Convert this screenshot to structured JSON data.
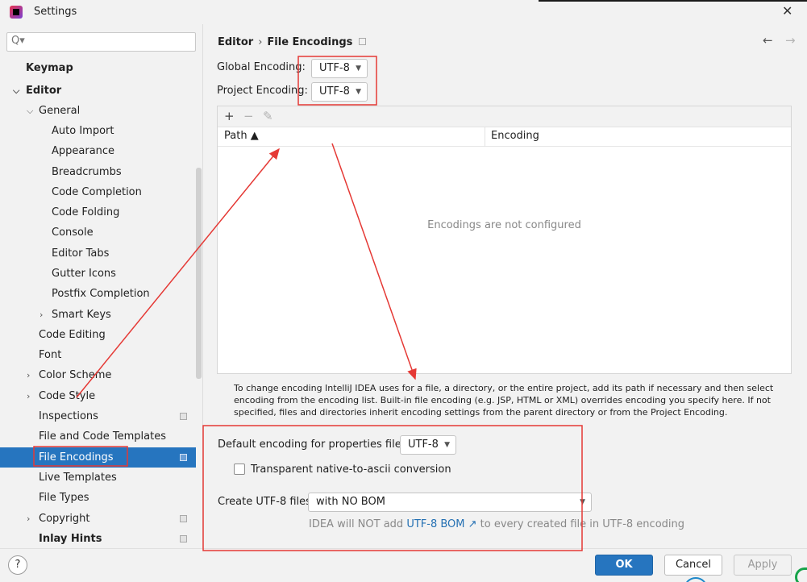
{
  "window": {
    "title": "Settings",
    "close_glyph": "✕"
  },
  "search": {
    "placeholder": "Q▾"
  },
  "sidebar": {
    "items": [
      {
        "label": "Keymap"
      },
      {
        "label": "Editor"
      },
      {
        "label": "General"
      },
      {
        "label": "Auto Import"
      },
      {
        "label": "Appearance"
      },
      {
        "label": "Breadcrumbs"
      },
      {
        "label": "Code Completion"
      },
      {
        "label": "Code Folding"
      },
      {
        "label": "Console"
      },
      {
        "label": "Editor Tabs"
      },
      {
        "label": "Gutter Icons"
      },
      {
        "label": "Postfix Completion"
      },
      {
        "label": "Smart Keys"
      },
      {
        "label": "Code Editing"
      },
      {
        "label": "Font"
      },
      {
        "label": "Color Scheme"
      },
      {
        "label": "Code Style"
      },
      {
        "label": "Inspections"
      },
      {
        "label": "File and Code Templates"
      },
      {
        "label": "File Encodings"
      },
      {
        "label": "Live Templates"
      },
      {
        "label": "File Types"
      },
      {
        "label": "Copyright"
      },
      {
        "label": "Inlay Hints"
      }
    ],
    "selected": "File Encodings"
  },
  "breadcrumb": {
    "parent": "Editor",
    "separator": "›",
    "current": "File Encodings"
  },
  "nav": {
    "back": "←",
    "forward": "→"
  },
  "encoding": {
    "global_label": "Global Encoding:",
    "global_value": "UTF-8",
    "project_label": "Project Encoding:",
    "project_value": "UTF-8"
  },
  "table": {
    "toolbar": {
      "add": "+",
      "remove": "−",
      "edit": "✎"
    },
    "columns": [
      "Path ▲",
      "Encoding"
    ],
    "empty_text": "Encodings are not configured"
  },
  "help_text": "To change encoding IntelliJ IDEA uses for a file, a directory, or the entire project, add its path if necessary and then select encoding from the encoding list. Built-in file encoding (e.g. JSP, HTML or XML) overrides encoding you specify here. If not specified, files and directories inherit encoding settings from the parent directory or from the Project Encoding.",
  "properties": {
    "default_label": "Default encoding for properties files:",
    "default_value": "UTF-8",
    "transparent_label": "Transparent native-to-ascii conversion",
    "transparent_checked": false
  },
  "utf8": {
    "create_label": "Create UTF-8 files:",
    "create_value": "with NO BOM",
    "hint_prefix": "IDEA will NOT add",
    "hint_link": "UTF-8 BOM ↗",
    "hint_suffix": "to every created file in UTF-8 encoding"
  },
  "footer": {
    "help": "?",
    "ok": "OK",
    "cancel": "Cancel",
    "apply": "Apply"
  },
  "annotations": {
    "color": "#e53935"
  }
}
